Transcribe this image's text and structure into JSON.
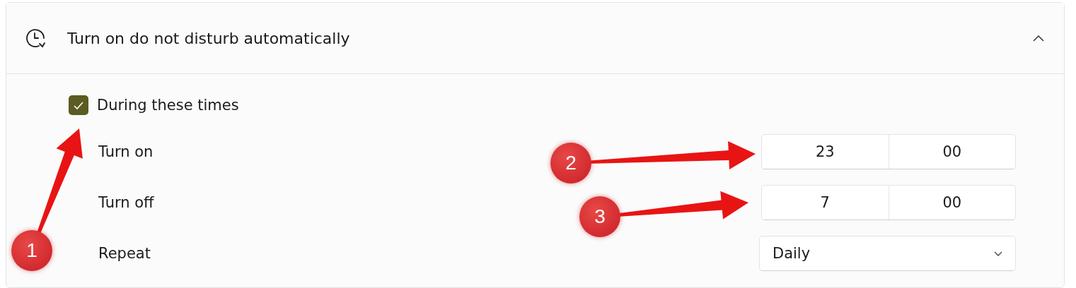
{
  "section": {
    "title": "Turn on do not disturb automatically",
    "expanded": true
  },
  "schedule": {
    "label": "During these times",
    "checked": true
  },
  "rows": [
    {
      "kind": "time",
      "label": "Turn on",
      "hour": "23",
      "minute": "00"
    },
    {
      "kind": "time",
      "label": "Turn off",
      "hour": "7",
      "minute": "00"
    },
    {
      "kind": "dropdown",
      "label": "Repeat",
      "value": "Daily"
    }
  ],
  "callouts": [
    {
      "number": "1"
    },
    {
      "number": "2"
    },
    {
      "number": "3"
    }
  ]
}
